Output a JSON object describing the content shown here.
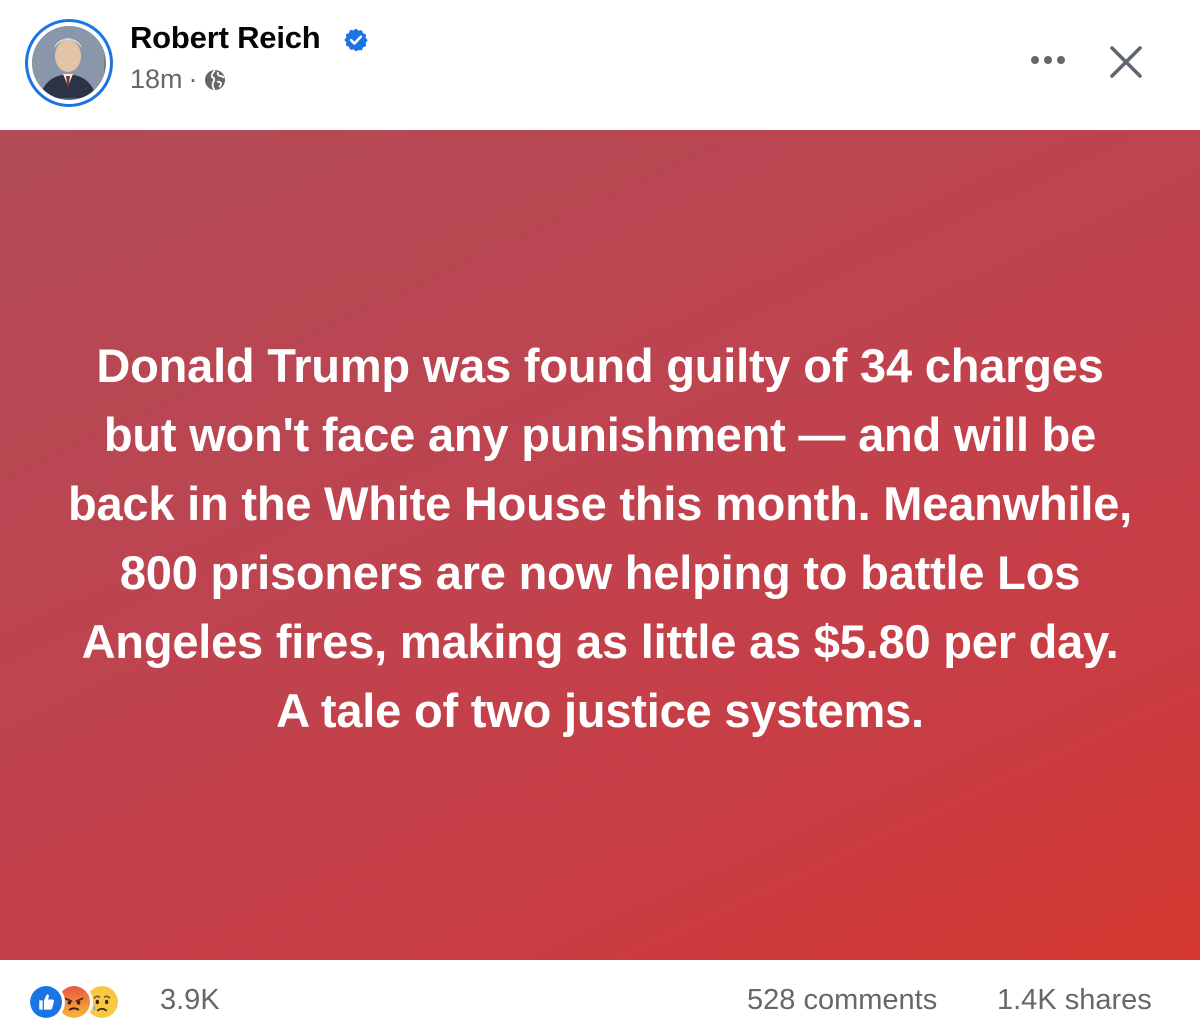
{
  "post": {
    "author": "Robert Reich",
    "timestamp": "18m",
    "separator": "·",
    "audience_icon": "globe-icon",
    "verified_icon": "verified-badge-icon",
    "text": "Donald Trump was found guilty of 34 charges but won't face any punishment — and will be back in the White House this month. Meanwhile, 800 prisoners are now helping to battle Los Angeles fires, making as little as $5.80 per day. A tale of two justice systems.",
    "background_gradient": [
      "#b14b56",
      "#d4382f"
    ]
  },
  "header_actions": {
    "more_icon": "more-options-icon",
    "close_icon": "close-icon"
  },
  "footer": {
    "reaction_icons": [
      "like-icon",
      "angry-icon",
      "sad-icon"
    ],
    "reaction_count": "3.9K",
    "comments": "528 comments",
    "shares": "1.4K shares"
  },
  "colors": {
    "accent": "#1b74e4",
    "secondary_text": "#65676b",
    "primary_text": "#050505"
  }
}
